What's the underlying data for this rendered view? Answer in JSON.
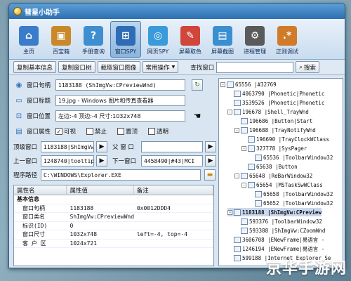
{
  "app": {
    "title": "彗星小助手"
  },
  "toolbar": {
    "tools": [
      {
        "label": "主页",
        "color": "#3a7cc9",
        "glyph": "⌂"
      },
      {
        "label": "百宝箱",
        "color": "#c9892a",
        "glyph": "▣"
      },
      {
        "label": "手册查询",
        "color": "#3f8fd0",
        "glyph": "?"
      },
      {
        "label": "窗口SPY",
        "color": "#2e6db5",
        "glyph": "⊞"
      },
      {
        "label": "网页SPY",
        "color": "#3b9ad9",
        "glyph": "◎"
      },
      {
        "label": "屏幕取色",
        "color": "#d0463a",
        "glyph": "✎"
      },
      {
        "label": "屏幕截图",
        "color": "#3a8fd0",
        "glyph": "▤"
      },
      {
        "label": "进程管理",
        "color": "#5a5a5a",
        "glyph": "⚙"
      },
      {
        "label": "正则调试",
        "color": "#d07a2a",
        "glyph": ".*"
      }
    ]
  },
  "cmdbar": {
    "copy_info": "复制基本信息",
    "copy_window": "复制窗口树",
    "capture": "截取窗口图像",
    "common_ops": "常用操作",
    "common_ops_arrow": "▼",
    "find_window_label": "查找窗口",
    "search": "搜索"
  },
  "fields": {
    "handle_label": "窗口句柄",
    "handle_value": "1183188 (ShImgVw:CPreviewWnd)",
    "title_label": "窗口标题",
    "title_value": "19.jpg - Windows 图片和传真查看器",
    "pos_label": "窗口位置",
    "pos_value": "左边:-4 顶边:-4 尺寸:1032x748",
    "attr_label": "窗口属性",
    "attr_visible": "可视",
    "attr_disabled": "禁止",
    "attr_topmost": "置顶",
    "attr_transparent": "透明",
    "top_label": "顶级窗口",
    "top_value": "1183188|ShImgVw:",
    "parent_label": "父 窗 口",
    "parent_value": "",
    "prev_label": "上一窗口",
    "prev_value": "1248740|tooltip",
    "next_label": "下一窗口",
    "next_value": "4458490|#43|MCI",
    "path_label": "程序路径",
    "path_value": "C:\\WINDOWS\\Explorer.EXE"
  },
  "props": {
    "headers": [
      "属性名",
      "属性值",
      "备注"
    ],
    "group": "基本信息",
    "rows": [
      {
        "name": "窗口句柄",
        "value": "1183188",
        "note": "0x0012DDD4"
      },
      {
        "name": "窗口类名",
        "value": "ShImgVw:CPreviewWnd",
        "note": ""
      },
      {
        "name": "标识(ID)",
        "value": "0",
        "note": ""
      },
      {
        "name": "窗口尺寸",
        "value": "1032x748",
        "note": "left=-4, top=-4"
      },
      {
        "name": "客 户 区",
        "value": "1024x721",
        "note": ""
      }
    ]
  },
  "tree": {
    "nodes": [
      {
        "text": "65556 |#32769",
        "exp": "-"
      },
      {
        "text": "4063790 |Phonetic|Phonetic",
        "exp": ""
      },
      {
        "text": "3539526 |Phonetic|Phonetic",
        "exp": ""
      },
      {
        "text": "196678 |Shell_TrayWnd",
        "exp": "-"
      },
      {
        "text": "196686 |Button|Start",
        "exp": ""
      },
      {
        "text": "196688 |TrayNotifyWnd",
        "exp": "-"
      },
      {
        "text": "196690 |TrayClockWClass",
        "exp": ""
      },
      {
        "text": "327778 |SysPager",
        "exp": "-"
      },
      {
        "text": "65536 |ToolbarWindow32",
        "exp": ""
      },
      {
        "text": "65638 |Button",
        "exp": ""
      },
      {
        "text": "65648 |ReBarWindow32",
        "exp": "-"
      },
      {
        "text": "65654 |MSTaskSwWClass",
        "exp": "-"
      },
      {
        "text": "65658 |ToolbarWindow32",
        "exp": ""
      },
      {
        "text": "65652 |ToolbarWindow32",
        "exp": ""
      },
      {
        "text": "1183188 |ShImgVw:CPreview",
        "exp": "-"
      },
      {
        "text": "593376 |ToolbarWindow32",
        "exp": ""
      },
      {
        "text": "593388 |ShImgVw:CZoomWnd",
        "exp": ""
      },
      {
        "text": "3606708 |ENewFrame|易语言 -",
        "exp": ""
      },
      {
        "text": "1246194 |ENewFrame|易语言 -",
        "exp": ""
      },
      {
        "text": "599188 |Internet Explorer_Se",
        "exp": ""
      }
    ]
  },
  "watermark": "京华手游网"
}
